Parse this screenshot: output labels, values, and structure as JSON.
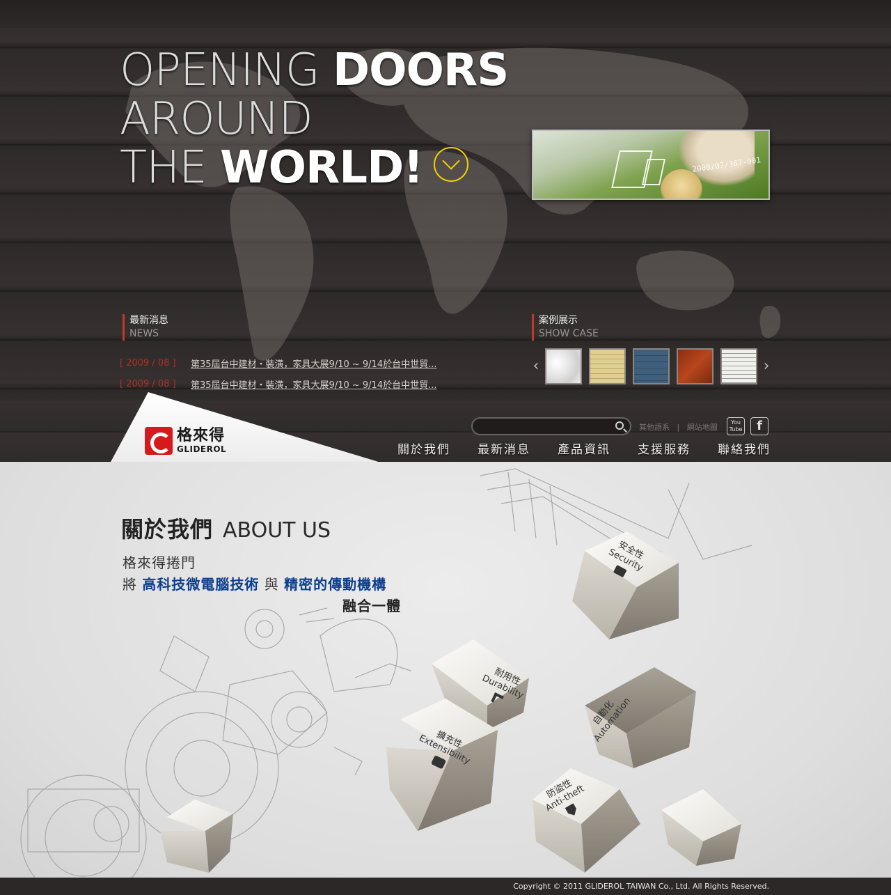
{
  "hero": {
    "headline_line1_thin": "OPENING ",
    "headline_line1_bold": "DOORS",
    "headline_line2_thin": "AROUND",
    "headline_line3_thin": "THE ",
    "headline_line3_bold": "WORLD!",
    "photo_text": "2008/07/367-001"
  },
  "news": {
    "title_zh": "最新消息",
    "title_en": "NEWS",
    "items": [
      {
        "date": "[ 2009 / 08 ]",
        "title": "第35屆台中建材・裝潢，家具大展9/10 ~ 9/14於台中世貿..."
      },
      {
        "date": "[ 2009 / 08 ]",
        "title": "第35屆台中建材・裝潢，家具大展9/10 ~ 9/14於台中世貿..."
      }
    ]
  },
  "cases": {
    "title_zh": "案例展示",
    "title_en": "SHOW CASE",
    "prev_icon": "chevron-left-icon",
    "next_icon": "chevron-right-icon",
    "prev_glyph": "‹",
    "next_glyph": "›"
  },
  "logo": {
    "zh": "格來得",
    "en": "GLIDEROL"
  },
  "search": {
    "placeholder": ""
  },
  "util_links": {
    "language": "其他語系",
    "sitemap": "網站地圖",
    "separator": "|"
  },
  "social": {
    "youtube_line1": "You",
    "youtube_line2": "Tube",
    "facebook": "f"
  },
  "nav": {
    "items": [
      "關於我們",
      "最新消息",
      "產品資訊",
      "支援服務",
      "聯絡我們"
    ]
  },
  "about": {
    "title_zh": "關於我們",
    "title_en": "ABOUT US",
    "line1": "格來得捲門",
    "line2_prefix": "將 ",
    "line2_hl1": "高科技微電腦技術",
    "line2_mid": " 與 ",
    "line2_hl2": "精密的傳動機構",
    "line3": "融合一體"
  },
  "features": [
    {
      "zh": "安全性",
      "en": "Security",
      "icon": "lock-icon"
    },
    {
      "zh": "耐用性",
      "en": "Durability",
      "icon": "hammer-icon"
    },
    {
      "zh": "自動化",
      "en": "Automation",
      "icon": "wifi-icon"
    },
    {
      "zh": "擴充性",
      "en": "Extensibility",
      "icon": "puzzle-icon"
    },
    {
      "zh": "防盜性",
      "en": "Anti-theft",
      "icon": "shield-icon"
    }
  ],
  "footer": {
    "copyright": "Copyright © 2011 GLIDEROL TAIWAN Co., Ltd. All Rights Reserved."
  },
  "colors": {
    "accent_red": "#c0392b",
    "link_blue": "#0d3f8e",
    "more_yellow": "#f2d200"
  }
}
